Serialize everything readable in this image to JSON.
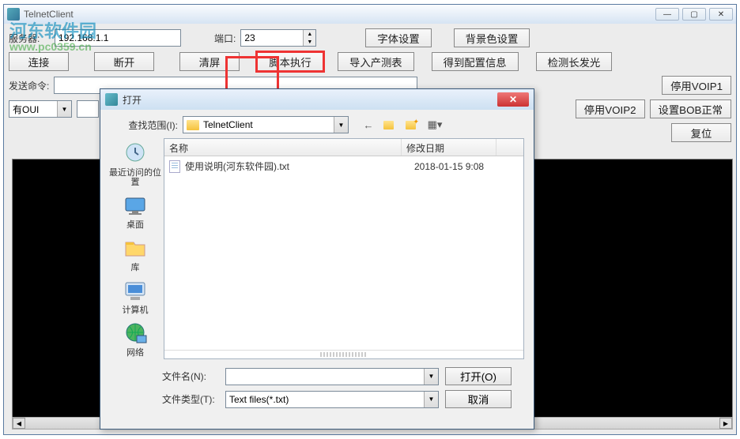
{
  "main": {
    "title": "TelnetClient",
    "server_label": "服务器:",
    "server_value": "192.168.1.1",
    "port_label": "端口:",
    "port_value": "23",
    "font_btn": "字体设置",
    "bg_btn": "背景色设置",
    "connect_btn": "连接",
    "disconnect_btn": "断开",
    "clear_btn": "清屏",
    "script_btn": "脚本执行",
    "import_btn": "导入产测表",
    "getconfig_btn": "得到配置信息",
    "detect_btn": "检测长发光",
    "send_label": "发送命令:",
    "oui_value": "有OUI",
    "stop_voip1": "停用VOIP1",
    "stop_voip2": "停用VOIP2",
    "set_bob": "设置BOB正常",
    "reset_btn": "复位"
  },
  "watermark": {
    "line1": "河东软件园",
    "line2": "www.pc0359.cn"
  },
  "dialog": {
    "title": "打开",
    "lookin_label": "查找范围(I):",
    "lookin_value": "TelnetClient",
    "places": {
      "recent": "最近访问的位置",
      "desktop": "桌面",
      "libraries": "库",
      "computer": "计算机",
      "network": "网络"
    },
    "columns": {
      "name": "名称",
      "date": "修改日期"
    },
    "files": [
      {
        "name": "使用说明(河东软件园).txt",
        "date": "2018-01-15 9:08"
      }
    ],
    "filename_label": "文件名(N):",
    "filename_value": "",
    "filetype_label": "文件类型(T):",
    "filetype_value": "Text files(*.txt)",
    "open_btn": "打开(O)",
    "cancel_btn": "取消"
  }
}
